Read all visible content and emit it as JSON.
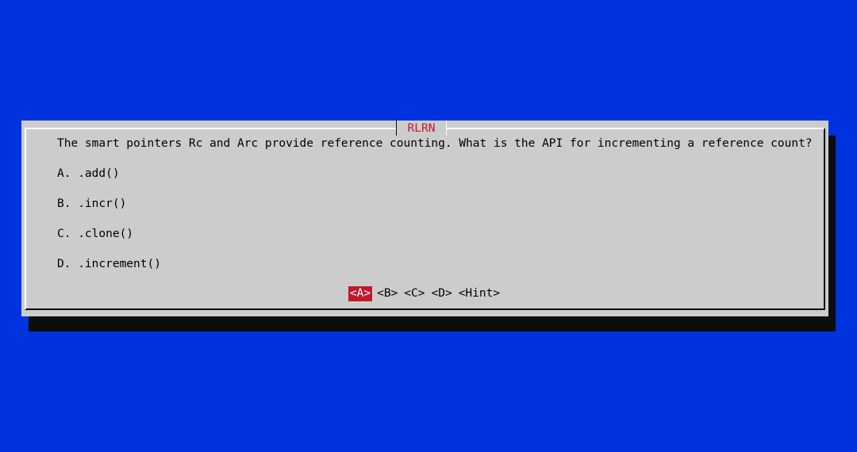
{
  "dialog": {
    "title": "RLRN",
    "question": "The smart pointers Rc and Arc provide reference counting. What is the API for incrementing a reference count?",
    "options": [
      "A. .add()",
      "B. .incr()",
      "C. .clone()",
      "D. .increment()"
    ],
    "buttons": [
      "<A>",
      "<B>",
      "<C>",
      "<D>",
      "<Hint>"
    ],
    "selected_button": "<A>"
  },
  "colors": {
    "background": "#0033dd",
    "dialog_bg": "#cccccc",
    "accent": "#c0192c",
    "shadow": "#0d0d0d"
  }
}
